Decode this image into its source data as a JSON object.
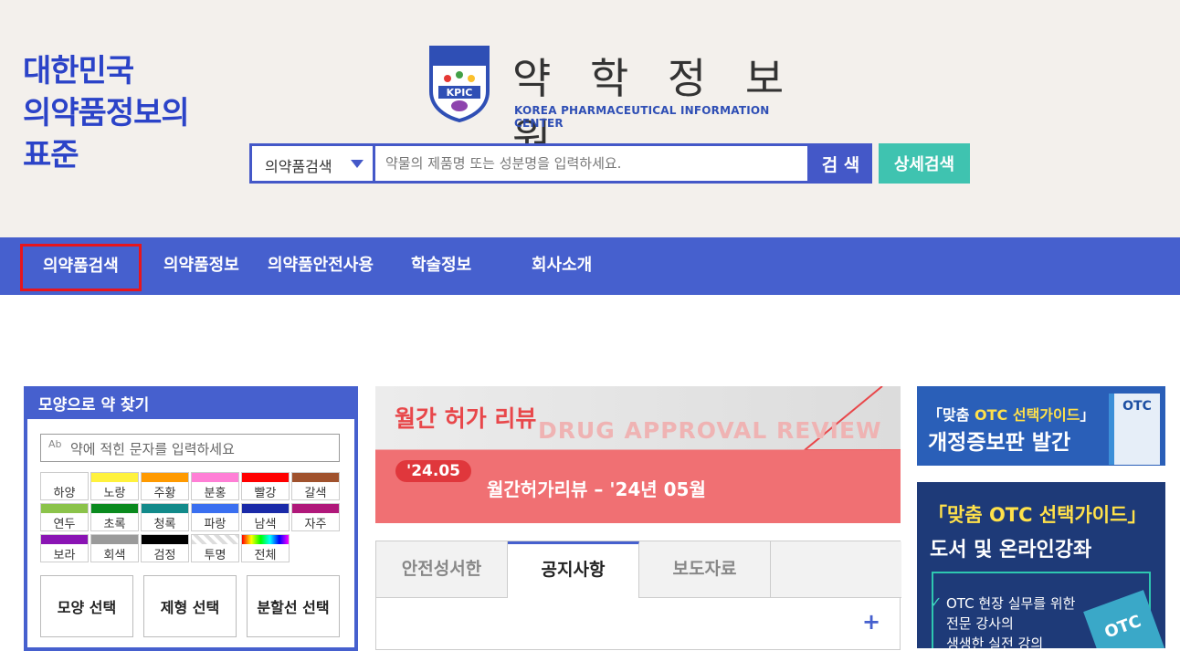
{
  "header": {
    "slogan": [
      "대한민국",
      "의약품정보의",
      "표준"
    ],
    "logo_title": "약 학 정 보 원",
    "logo_subtitle": "KOREA PHARMACEUTICAL INFORMATION CENTER",
    "logo_badge": "KPIC",
    "search": {
      "category": "의약품검색",
      "placeholder": "약물의 제품명 또는 성분명을 입력하세요.",
      "search_label": "검 색",
      "detail_label": "상세검색"
    }
  },
  "nav": {
    "items": [
      "의약품검색",
      "의약품정보",
      "의약품안전사용",
      "학술정보",
      "회사소개"
    ]
  },
  "shape_search": {
    "title": "모양으로 약 찾기",
    "input_placeholder": "약에 적힌 문자를 입력하세요",
    "colors": [
      {
        "label": "하양",
        "hex": "#ffffff"
      },
      {
        "label": "노랑",
        "hex": "#fff23d"
      },
      {
        "label": "주황",
        "hex": "#ff9a00"
      },
      {
        "label": "분홍",
        "hex": "#ff7fd6"
      },
      {
        "label": "빨강",
        "hex": "#ff0000"
      },
      {
        "label": "갈색",
        "hex": "#a0522d"
      },
      {
        "label": "연두",
        "hex": "#8bc34a"
      },
      {
        "label": "초록",
        "hex": "#0a8a1e"
      },
      {
        "label": "청록",
        "hex": "#128a8a"
      },
      {
        "label": "파랑",
        "hex": "#3a6ff0"
      },
      {
        "label": "남색",
        "hex": "#1a2aa8"
      },
      {
        "label": "자주",
        "hex": "#b0187a"
      },
      {
        "label": "보라",
        "hex": "#8a14b4"
      },
      {
        "label": "회색",
        "hex": "#9a9a9a"
      },
      {
        "label": "검정",
        "hex": "#000000"
      },
      {
        "label": "투명",
        "hex": "transparent"
      },
      {
        "label": "전체",
        "hex": "rainbow"
      }
    ],
    "buttons": [
      "모양 선택",
      "제형 선택",
      "분할선 선택"
    ]
  },
  "banner": {
    "title": "월간 허가 리뷰",
    "title_en": "DRUG APPROVAL REVIEW",
    "date_badge": "'24.05",
    "text": "월간허가리뷰 – '24년 05월"
  },
  "tabs": {
    "items": [
      "안전성서한",
      "공지사항",
      "보도자료"
    ],
    "active": "공지사항",
    "more": "+"
  },
  "ads": {
    "ad1_line1_a": "「맞춤 ",
    "ad1_line1_b": "OTC 선택가이드",
    "ad1_line1_c": "」",
    "ad1_line2": "개정증보판 발간",
    "ad1_book": "OTC",
    "ad2_line1": "「맞춤 OTC 선택가이드」",
    "ad2_line2": "도서 및 온라인강좌",
    "ad2_check": "✓",
    "ad2_lines": [
      "OTC 현장 실무를 위한",
      "전문 강사의",
      "생생한 실전 강의"
    ],
    "ad2_book": "OTC"
  },
  "colors": {
    "brand": "#4660ce",
    "slogan": "#2b43c8",
    "accent_teal": "#3fc3b0",
    "highlight": "#e8151b"
  }
}
